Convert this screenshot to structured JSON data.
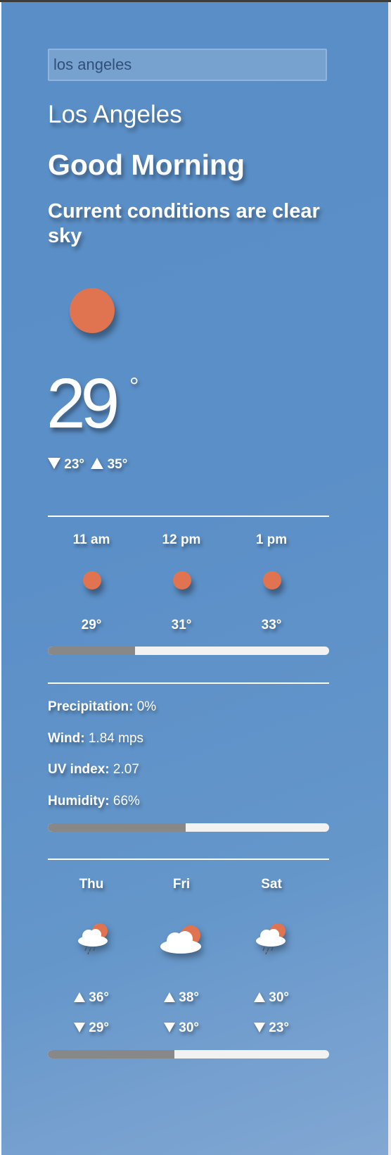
{
  "search": {
    "value": "los angeles"
  },
  "location": {
    "city": "Los Angeles"
  },
  "greeting": "Good Morning",
  "conditions": "Current conditions are clear sky",
  "current": {
    "temperature": "29",
    "degree_symbol": "°",
    "low": "23°",
    "high": "35°",
    "icon": "sun-icon"
  },
  "hourly": {
    "items": [
      {
        "time": "11 am",
        "temp": "29°",
        "icon": "sun-icon"
      },
      {
        "time": "12 pm",
        "temp": "31°",
        "icon": "sun-icon"
      },
      {
        "time": "1 pm",
        "temp": "33°",
        "icon": "sun-icon"
      }
    ],
    "scroll_position": 0.31
  },
  "details": {
    "precipitation": {
      "label": "Precipitation:",
      "value": "0%"
    },
    "wind": {
      "label": "Wind:",
      "value": "1.84 mps"
    },
    "uv": {
      "label": "UV index:",
      "value": "2.07"
    },
    "humidity": {
      "label": "Humidity:",
      "value": "66%"
    },
    "scroll_position": 0.49
  },
  "daily": {
    "items": [
      {
        "day": "Thu",
        "high": "36°",
        "low": "29°",
        "icon": "cloud-sun-rain-icon"
      },
      {
        "day": "Fri",
        "high": "38°",
        "low": "30°",
        "icon": "cloud-sun-icon"
      },
      {
        "day": "Sat",
        "high": "30°",
        "low": "23°",
        "icon": "cloud-sun-rain-icon"
      }
    ],
    "scroll_position": 0.45
  },
  "colors": {
    "background": "#5b8fc7",
    "sun": "#e07350",
    "progress_track": "#f2f2f2",
    "progress_fill": "#888888",
    "text": "#ffffff"
  }
}
